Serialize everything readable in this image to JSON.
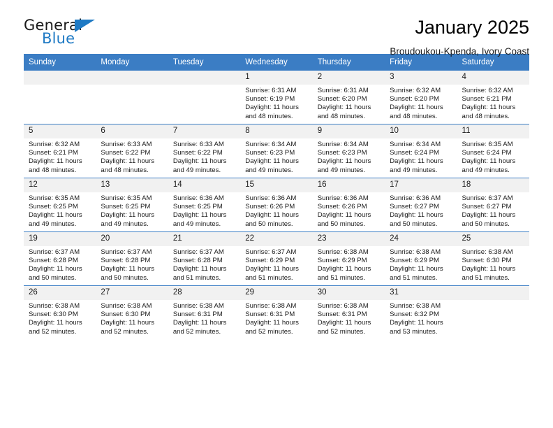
{
  "logo": {
    "word_top": "General",
    "word_bottom": "Blue",
    "triangle_color": "#1f7ac4"
  },
  "header": {
    "title": "January 2025",
    "subtitle": "Broudoukou-Kpenda, Ivory Coast",
    "header_bg_color": "#3b7dc4",
    "daynum_bg_color": "#f1f1f1"
  },
  "weekdays": [
    "Sunday",
    "Monday",
    "Tuesday",
    "Wednesday",
    "Thursday",
    "Friday",
    "Saturday"
  ],
  "weeks": [
    [
      {
        "day": "",
        "lines": []
      },
      {
        "day": "",
        "lines": []
      },
      {
        "day": "",
        "lines": []
      },
      {
        "day": "1",
        "lines": [
          "Sunrise: 6:31 AM",
          "Sunset: 6:19 PM",
          "Daylight: 11 hours",
          "and 48 minutes."
        ]
      },
      {
        "day": "2",
        "lines": [
          "Sunrise: 6:31 AM",
          "Sunset: 6:20 PM",
          "Daylight: 11 hours",
          "and 48 minutes."
        ]
      },
      {
        "day": "3",
        "lines": [
          "Sunrise: 6:32 AM",
          "Sunset: 6:20 PM",
          "Daylight: 11 hours",
          "and 48 minutes."
        ]
      },
      {
        "day": "4",
        "lines": [
          "Sunrise: 6:32 AM",
          "Sunset: 6:21 PM",
          "Daylight: 11 hours",
          "and 48 minutes."
        ]
      }
    ],
    [
      {
        "day": "5",
        "lines": [
          "Sunrise: 6:32 AM",
          "Sunset: 6:21 PM",
          "Daylight: 11 hours",
          "and 48 minutes."
        ]
      },
      {
        "day": "6",
        "lines": [
          "Sunrise: 6:33 AM",
          "Sunset: 6:22 PM",
          "Daylight: 11 hours",
          "and 48 minutes."
        ]
      },
      {
        "day": "7",
        "lines": [
          "Sunrise: 6:33 AM",
          "Sunset: 6:22 PM",
          "Daylight: 11 hours",
          "and 49 minutes."
        ]
      },
      {
        "day": "8",
        "lines": [
          "Sunrise: 6:34 AM",
          "Sunset: 6:23 PM",
          "Daylight: 11 hours",
          "and 49 minutes."
        ]
      },
      {
        "day": "9",
        "lines": [
          "Sunrise: 6:34 AM",
          "Sunset: 6:23 PM",
          "Daylight: 11 hours",
          "and 49 minutes."
        ]
      },
      {
        "day": "10",
        "lines": [
          "Sunrise: 6:34 AM",
          "Sunset: 6:24 PM",
          "Daylight: 11 hours",
          "and 49 minutes."
        ]
      },
      {
        "day": "11",
        "lines": [
          "Sunrise: 6:35 AM",
          "Sunset: 6:24 PM",
          "Daylight: 11 hours",
          "and 49 minutes."
        ]
      }
    ],
    [
      {
        "day": "12",
        "lines": [
          "Sunrise: 6:35 AM",
          "Sunset: 6:25 PM",
          "Daylight: 11 hours",
          "and 49 minutes."
        ]
      },
      {
        "day": "13",
        "lines": [
          "Sunrise: 6:35 AM",
          "Sunset: 6:25 PM",
          "Daylight: 11 hours",
          "and 49 minutes."
        ]
      },
      {
        "day": "14",
        "lines": [
          "Sunrise: 6:36 AM",
          "Sunset: 6:25 PM",
          "Daylight: 11 hours",
          "and 49 minutes."
        ]
      },
      {
        "day": "15",
        "lines": [
          "Sunrise: 6:36 AM",
          "Sunset: 6:26 PM",
          "Daylight: 11 hours",
          "and 50 minutes."
        ]
      },
      {
        "day": "16",
        "lines": [
          "Sunrise: 6:36 AM",
          "Sunset: 6:26 PM",
          "Daylight: 11 hours",
          "and 50 minutes."
        ]
      },
      {
        "day": "17",
        "lines": [
          "Sunrise: 6:36 AM",
          "Sunset: 6:27 PM",
          "Daylight: 11 hours",
          "and 50 minutes."
        ]
      },
      {
        "day": "18",
        "lines": [
          "Sunrise: 6:37 AM",
          "Sunset: 6:27 PM",
          "Daylight: 11 hours",
          "and 50 minutes."
        ]
      }
    ],
    [
      {
        "day": "19",
        "lines": [
          "Sunrise: 6:37 AM",
          "Sunset: 6:28 PM",
          "Daylight: 11 hours",
          "and 50 minutes."
        ]
      },
      {
        "day": "20",
        "lines": [
          "Sunrise: 6:37 AM",
          "Sunset: 6:28 PM",
          "Daylight: 11 hours",
          "and 50 minutes."
        ]
      },
      {
        "day": "21",
        "lines": [
          "Sunrise: 6:37 AM",
          "Sunset: 6:28 PM",
          "Daylight: 11 hours",
          "and 51 minutes."
        ]
      },
      {
        "day": "22",
        "lines": [
          "Sunrise: 6:37 AM",
          "Sunset: 6:29 PM",
          "Daylight: 11 hours",
          "and 51 minutes."
        ]
      },
      {
        "day": "23",
        "lines": [
          "Sunrise: 6:38 AM",
          "Sunset: 6:29 PM",
          "Daylight: 11 hours",
          "and 51 minutes."
        ]
      },
      {
        "day": "24",
        "lines": [
          "Sunrise: 6:38 AM",
          "Sunset: 6:29 PM",
          "Daylight: 11 hours",
          "and 51 minutes."
        ]
      },
      {
        "day": "25",
        "lines": [
          "Sunrise: 6:38 AM",
          "Sunset: 6:30 PM",
          "Daylight: 11 hours",
          "and 51 minutes."
        ]
      }
    ],
    [
      {
        "day": "26",
        "lines": [
          "Sunrise: 6:38 AM",
          "Sunset: 6:30 PM",
          "Daylight: 11 hours",
          "and 52 minutes."
        ]
      },
      {
        "day": "27",
        "lines": [
          "Sunrise: 6:38 AM",
          "Sunset: 6:30 PM",
          "Daylight: 11 hours",
          "and 52 minutes."
        ]
      },
      {
        "day": "28",
        "lines": [
          "Sunrise: 6:38 AM",
          "Sunset: 6:31 PM",
          "Daylight: 11 hours",
          "and 52 minutes."
        ]
      },
      {
        "day": "29",
        "lines": [
          "Sunrise: 6:38 AM",
          "Sunset: 6:31 PM",
          "Daylight: 11 hours",
          "and 52 minutes."
        ]
      },
      {
        "day": "30",
        "lines": [
          "Sunrise: 6:38 AM",
          "Sunset: 6:31 PM",
          "Daylight: 11 hours",
          "and 52 minutes."
        ]
      },
      {
        "day": "31",
        "lines": [
          "Sunrise: 6:38 AM",
          "Sunset: 6:32 PM",
          "Daylight: 11 hours",
          "and 53 minutes."
        ]
      },
      {
        "day": "",
        "lines": []
      }
    ]
  ]
}
